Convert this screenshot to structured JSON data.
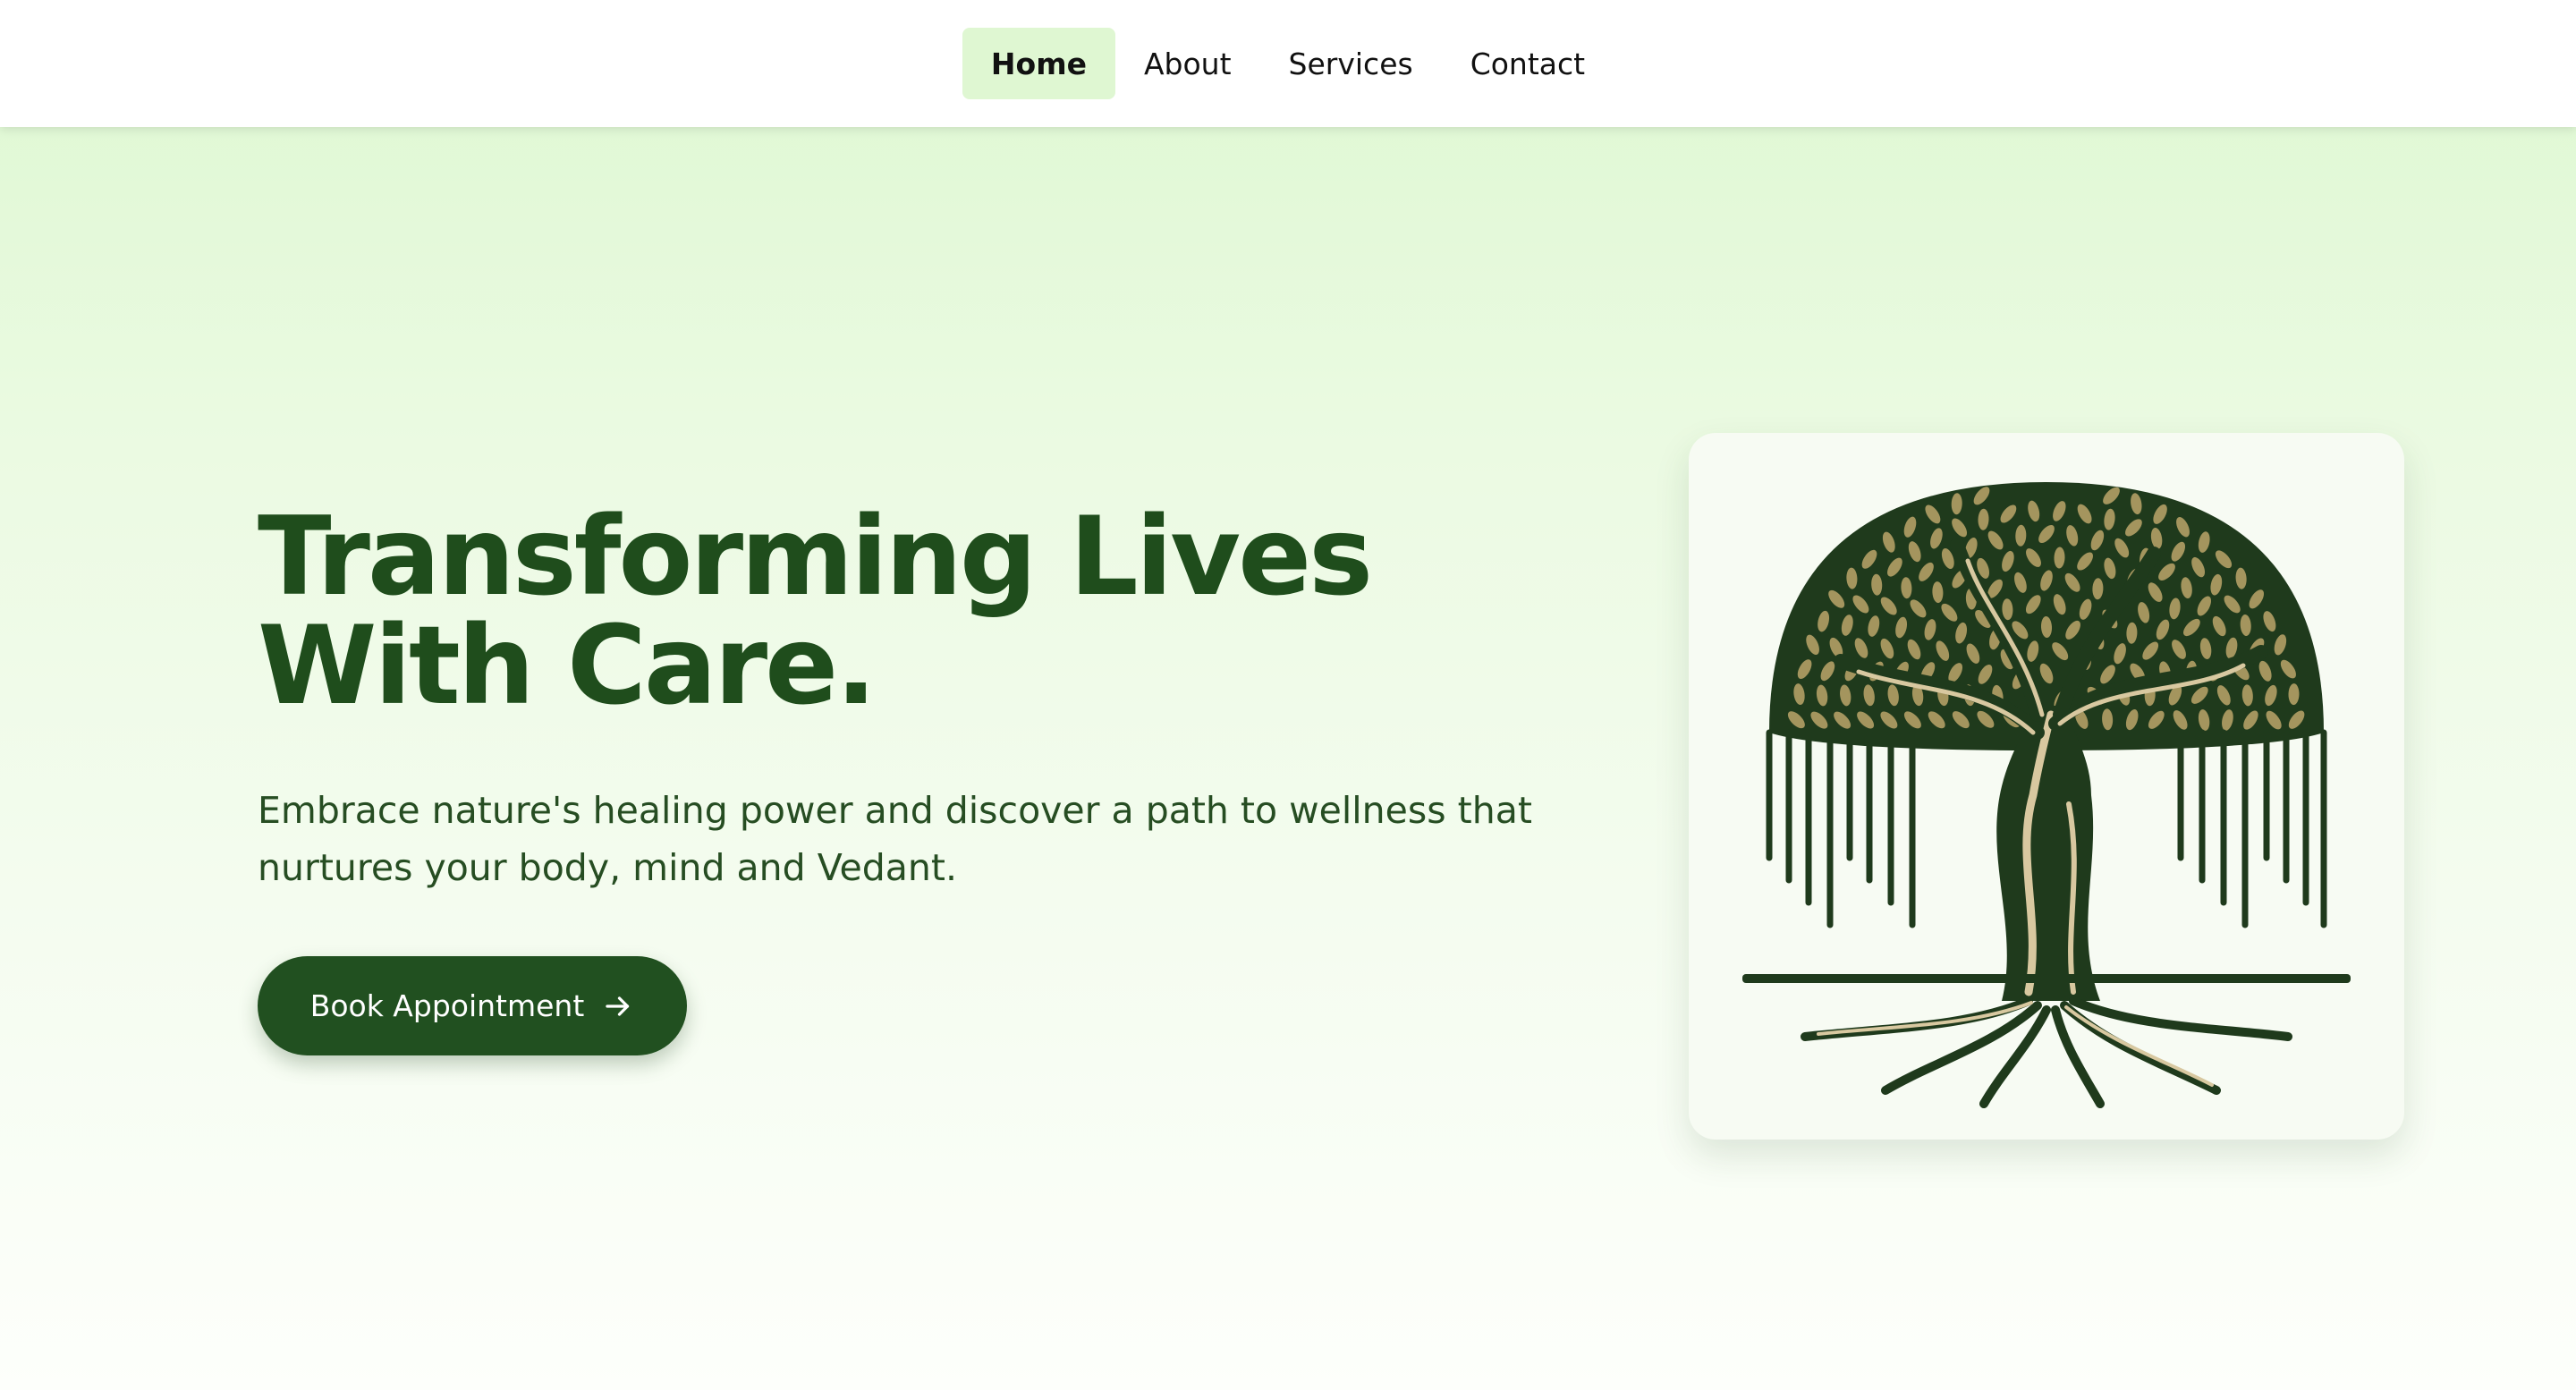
{
  "nav": {
    "items": [
      {
        "label": "Home",
        "active": true
      },
      {
        "label": "About",
        "active": false
      },
      {
        "label": "Services",
        "active": false
      },
      {
        "label": "Contact",
        "active": false
      }
    ]
  },
  "hero": {
    "title": "Transforming Lives With Care.",
    "subtitle": "Embrace nature's healing power and discover a path to wellness that nurtures your body, mind and Vedant.",
    "cta_label": "Book Appointment",
    "cta_icon": "arrow-right-icon",
    "image_icon": "tree-of-life-logo"
  },
  "colors": {
    "brand_dark_green": "#215020",
    "heading_green": "#1f4d1c",
    "active_nav_bg": "#dff7d2",
    "leaf_tan": "#a4955e",
    "root_cream": "#d8c8a0"
  }
}
